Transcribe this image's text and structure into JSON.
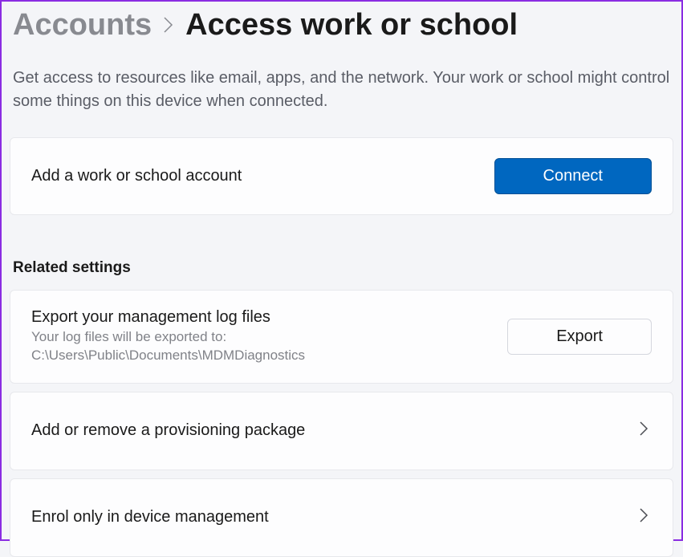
{
  "breadcrumb": {
    "parent": "Accounts",
    "current": "Access work or school"
  },
  "description": "Get access to resources like email, apps, and the network. Your work or school might control some things on this device when connected.",
  "addAccount": {
    "title": "Add a work or school account",
    "button": "Connect"
  },
  "relatedSettings": {
    "heading": "Related settings",
    "export": {
      "title": "Export your management log files",
      "subtitle": "Your log files will be exported to: C:\\Users\\Public\\Documents\\MDMDiagnostics",
      "button": "Export"
    },
    "provisioning": {
      "title": "Add or remove a provisioning package"
    },
    "enrol": {
      "title": "Enrol only in device management"
    }
  }
}
